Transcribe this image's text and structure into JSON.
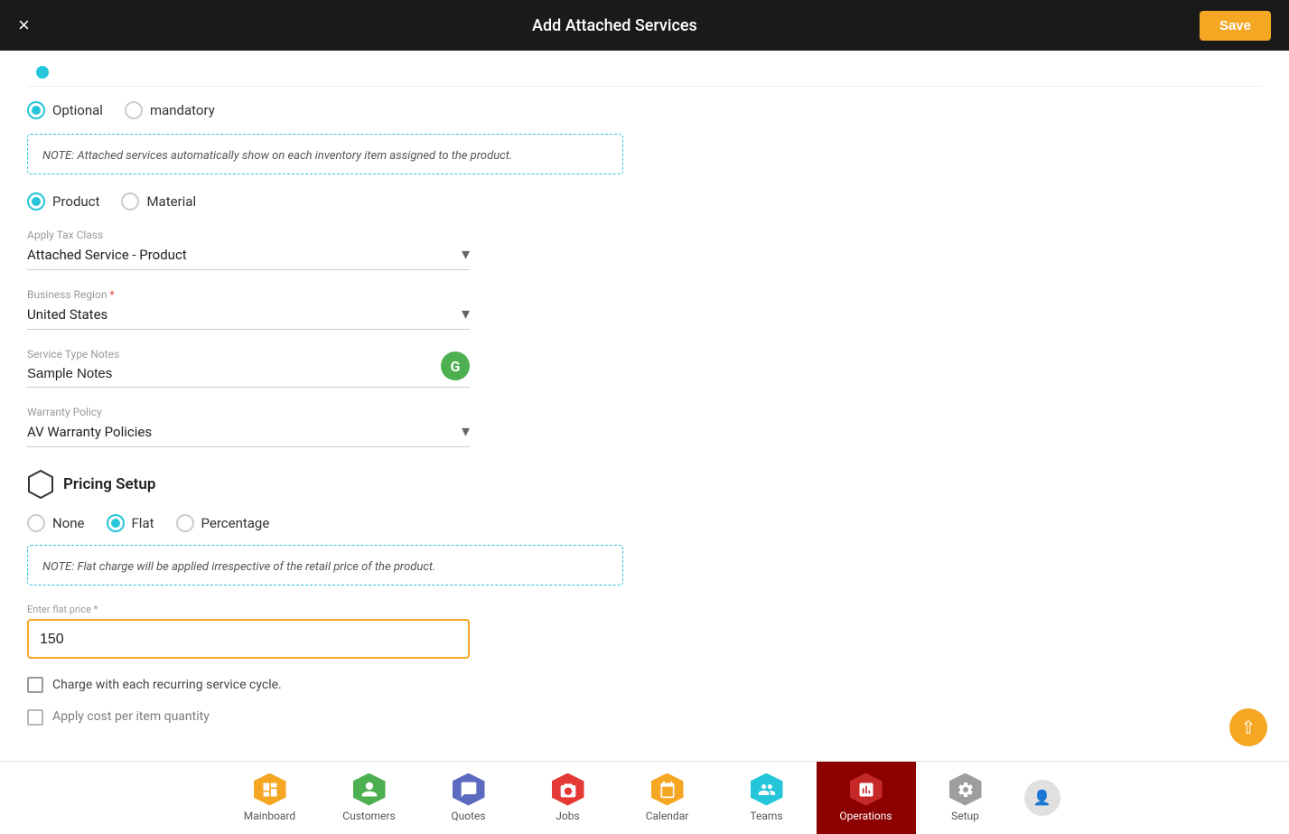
{
  "header": {
    "title": "Add Attached Services",
    "close_label": "×",
    "save_label": "Save"
  },
  "form": {
    "optional_label": "Optional",
    "mandatory_label": "mandatory",
    "note_text": "NOTE: Attached services automatically show on each inventory item assigned to the product.",
    "product_label": "Product",
    "material_label": "Material",
    "apply_tax_class_label": "Apply Tax Class",
    "apply_tax_class_value": "Attached Service - Product",
    "business_region_label": "Business Region",
    "business_region_required": "*",
    "business_region_value": "United States",
    "service_type_notes_label": "Service Type Notes",
    "service_type_notes_value": "Sample Notes",
    "warranty_policy_label": "Warranty Policy",
    "warranty_policy_value": "AV Warranty Policies",
    "pricing_setup_label": "Pricing Setup",
    "pricing_none_label": "None",
    "pricing_flat_label": "Flat",
    "pricing_percentage_label": "Percentage",
    "flat_note_text": "NOTE: Flat charge will be applied irrespective of the retail price of the product.",
    "enter_flat_price_label": "Enter flat price *",
    "flat_price_value": "150",
    "charge_recurring_label": "Charge with each recurring service cycle.",
    "apply_cost_label": "Apply cost per item quantity"
  },
  "bottom_nav": {
    "items": [
      {
        "id": "mainboard",
        "label": "Mainboard",
        "icon": "🏠",
        "active": false
      },
      {
        "id": "customers",
        "label": "Customers",
        "icon": "👤",
        "active": false
      },
      {
        "id": "quotes",
        "label": "Quotes",
        "icon": "📋",
        "active": false
      },
      {
        "id": "jobs",
        "label": "Jobs",
        "icon": "🔧",
        "active": false
      },
      {
        "id": "calendar",
        "label": "Calendar",
        "icon": "📅",
        "active": false
      },
      {
        "id": "teams",
        "label": "Teams",
        "icon": "👥",
        "active": false
      },
      {
        "id": "operations",
        "label": "Operations",
        "icon": "📦",
        "active": true
      },
      {
        "id": "setup",
        "label": "Setup",
        "icon": "⚙️",
        "active": false
      }
    ]
  }
}
